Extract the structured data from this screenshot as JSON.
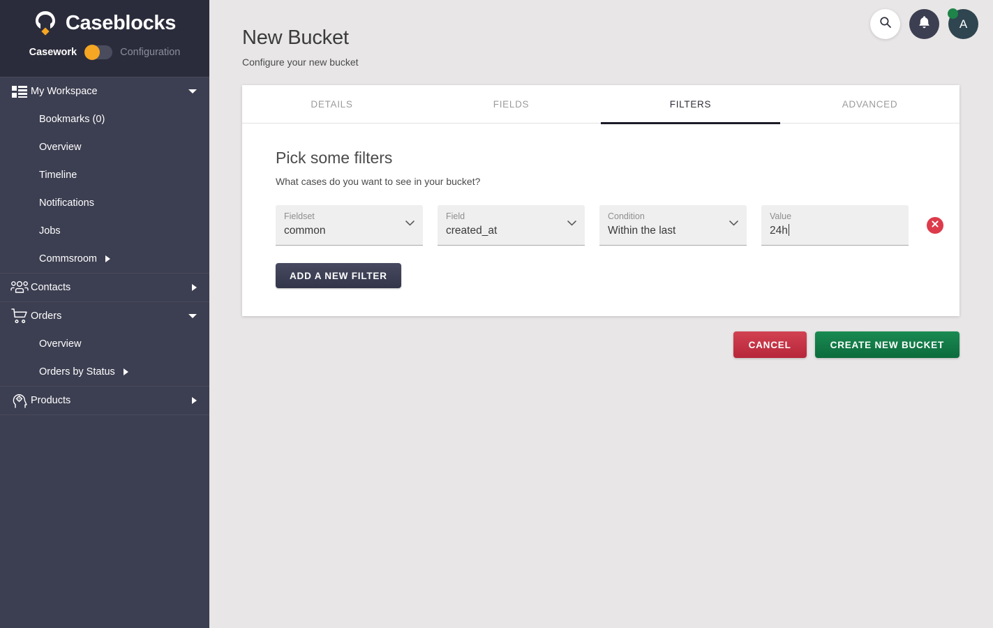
{
  "brand": {
    "name": "Caseblocks",
    "logo_icon": "horseshoe-diamond-logo",
    "toggle_left_label": "Casework",
    "toggle_right_label": "Configuration",
    "toggle_state": "Casework",
    "accent_color": "#f5a623",
    "sidebar_bg": "#3c3e51",
    "brand_bg": "#2b2c3b"
  },
  "sidebar": {
    "groups": [
      {
        "header": {
          "label": "My Workspace",
          "icon": "grid-list-icon",
          "caret": "down"
        },
        "items": [
          {
            "label": "Bookmarks (0)",
            "caret": "none"
          },
          {
            "label": "Overview",
            "caret": "none"
          },
          {
            "label": "Timeline",
            "caret": "none"
          },
          {
            "label": "Notifications",
            "caret": "none"
          },
          {
            "label": "Jobs",
            "caret": "none"
          },
          {
            "label": "Commsroom",
            "caret": "right"
          }
        ]
      },
      {
        "header": {
          "label": "Contacts",
          "icon": "people-group-icon",
          "caret": "right"
        },
        "items": []
      },
      {
        "header": {
          "label": "Orders",
          "icon": "shopping-cart-icon",
          "caret": "down"
        },
        "items": [
          {
            "label": "Overview",
            "caret": "none"
          },
          {
            "label": "Orders by Status",
            "caret": "right"
          }
        ]
      },
      {
        "header": {
          "label": "Products",
          "icon": "head-gear-icon",
          "caret": "right"
        },
        "items": []
      }
    ]
  },
  "topbar": {
    "search_icon": "search-icon",
    "notifications_icon": "bell-icon",
    "avatar_initial": "A",
    "avatar_status": "online",
    "status_color": "#1e8449"
  },
  "page": {
    "title": "New Bucket",
    "subtitle": "Configure your new bucket"
  },
  "tabs": [
    {
      "label": "DETAILS",
      "active": false
    },
    {
      "label": "FIELDS",
      "active": false
    },
    {
      "label": "FILTERS",
      "active": true
    },
    {
      "label": "ADVANCED",
      "active": false
    }
  ],
  "filters_panel": {
    "heading": "Pick some filters",
    "subheading": "What cases do you want to see in your bucket?",
    "rows": [
      {
        "fieldset": {
          "label": "Fieldset",
          "value": "common",
          "type": "select"
        },
        "field": {
          "label": "Field",
          "value": "created_at",
          "type": "select"
        },
        "condition": {
          "label": "Condition",
          "value": "Within the last",
          "type": "select"
        },
        "value": {
          "label": "Value",
          "value": "24h",
          "type": "text",
          "focused": true
        },
        "delete_icon": "close-circle-icon"
      }
    ],
    "add_filter_label": "ADD A NEW FILTER"
  },
  "footer": {
    "cancel_label": "CANCEL",
    "create_label": "CREATE NEW BUCKET",
    "cancel_color": "#c0392b",
    "create_color": "#12743f"
  }
}
